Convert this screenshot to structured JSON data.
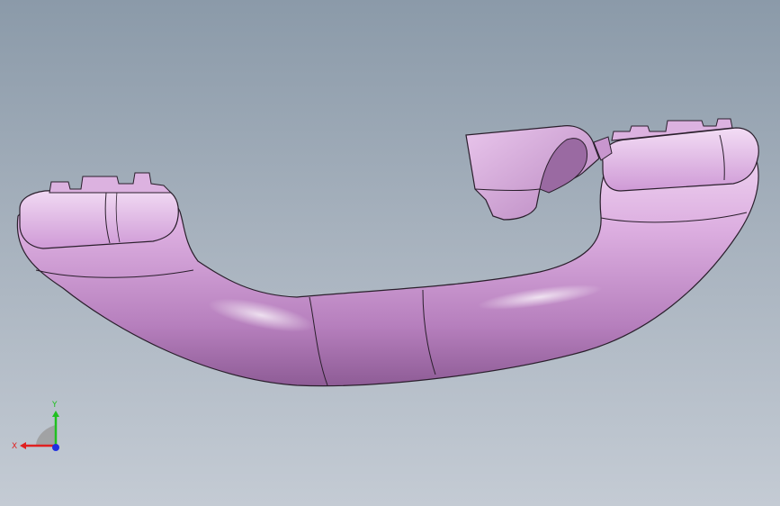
{
  "viewport": {
    "background_top": "#8b9aa9",
    "background_bottom": "#c4cbd4"
  },
  "model": {
    "icon": "grab-handle-part",
    "color": "#d6a6dc",
    "edge_color": "#2a1f2c"
  },
  "triad": {
    "x_label": "X",
    "y_label": "Y",
    "x_color": "#e02020",
    "y_color": "#20c020",
    "z_color": "#2030e0"
  }
}
